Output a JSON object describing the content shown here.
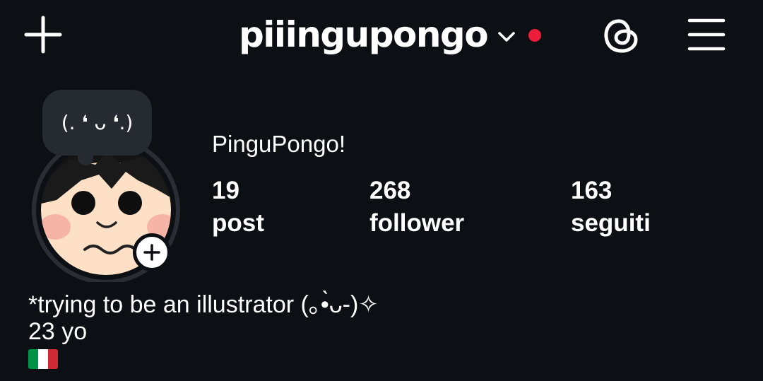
{
  "header": {
    "username": "piiingupongo",
    "add_icon": "plus-icon",
    "switch_icon": "chevron-down-icon",
    "notification_dot_color": "#ee1d3c",
    "threads_icon": "threads-icon",
    "menu_icon": "hamburger-menu-icon"
  },
  "profile": {
    "note": "(. ❛ ᴗ ❛.)",
    "display_name": "PinguPongo!",
    "add_story_icon": "plus-icon"
  },
  "stats": {
    "posts": {
      "value": "19",
      "label": "post"
    },
    "followers": {
      "value": "268",
      "label": "follower"
    },
    "following": {
      "value": "163",
      "label": "seguiti"
    }
  },
  "bio": {
    "line1": "*trying to be an illustrator (｡•̀ᴗ-)✧",
    "line2": "23 yo",
    "flag": "italy-flag",
    "flag_colors": [
      "#009246",
      "#ffffff",
      "#ce2b37"
    ]
  },
  "colors": {
    "background": "#0c0f14",
    "text": "#ffffff",
    "bubble": "#262a31"
  }
}
